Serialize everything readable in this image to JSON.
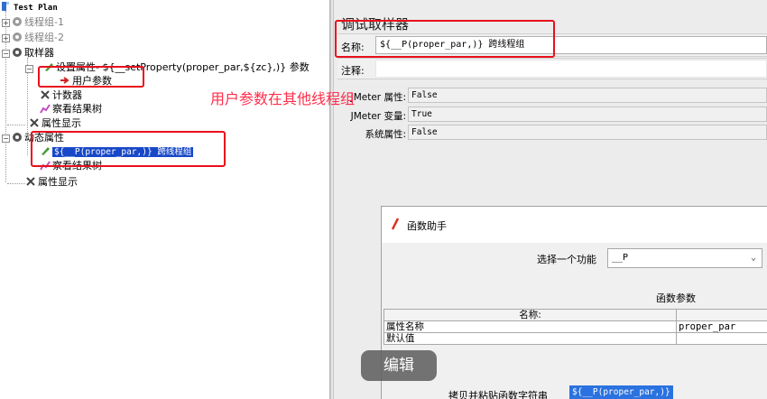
{
  "tree": {
    "root": "Test Plan",
    "thread_group_1": "线程组-1",
    "thread_group_2": "线程组-2",
    "sampler_group": "取样器",
    "set_property": "设置属性-  ${__setProperty(proper_par,${zc},)} 参数",
    "user_params": "用户参数",
    "counter": "计数器",
    "view_results": "察看结果树",
    "property_display": "属性显示",
    "dynamic_property": "动态属性",
    "selected_sampler": "${__P(proper_par,)}  跨线程组",
    "view_results_2": "察看结果树",
    "property_display_2": "属性显示"
  },
  "annotation": "用户参数在其他线程组",
  "edit_overlay": "编辑",
  "panel": {
    "title": "调试取样器",
    "name_label": "名称:",
    "name_value": "${__P(proper_par,)}  跨线程组",
    "comment_label": "注释:",
    "comment_value": "",
    "properties": [
      {
        "label": "JMeter 属性:",
        "value": "False"
      },
      {
        "label": "JMeter 变量:",
        "value": "True"
      },
      {
        "label": "系统属性:",
        "value": "False"
      }
    ]
  },
  "function_helper": {
    "title": "函数助手",
    "select_label": "选择一个功能",
    "select_value": "__P",
    "params_heading": "函数参数",
    "table_header": "名称:",
    "rows": [
      {
        "name": "属性名称",
        "value": "proper_par"
      },
      {
        "name": "默认值",
        "value": ""
      }
    ],
    "copy_label": "拷贝并粘贴函数字符串",
    "copy_value": "${__P(proper_par,)}"
  },
  "colors": {
    "highlight_box": "#e8101c",
    "annotation_text": "#ff2d4a",
    "selection": "#1848c8"
  }
}
